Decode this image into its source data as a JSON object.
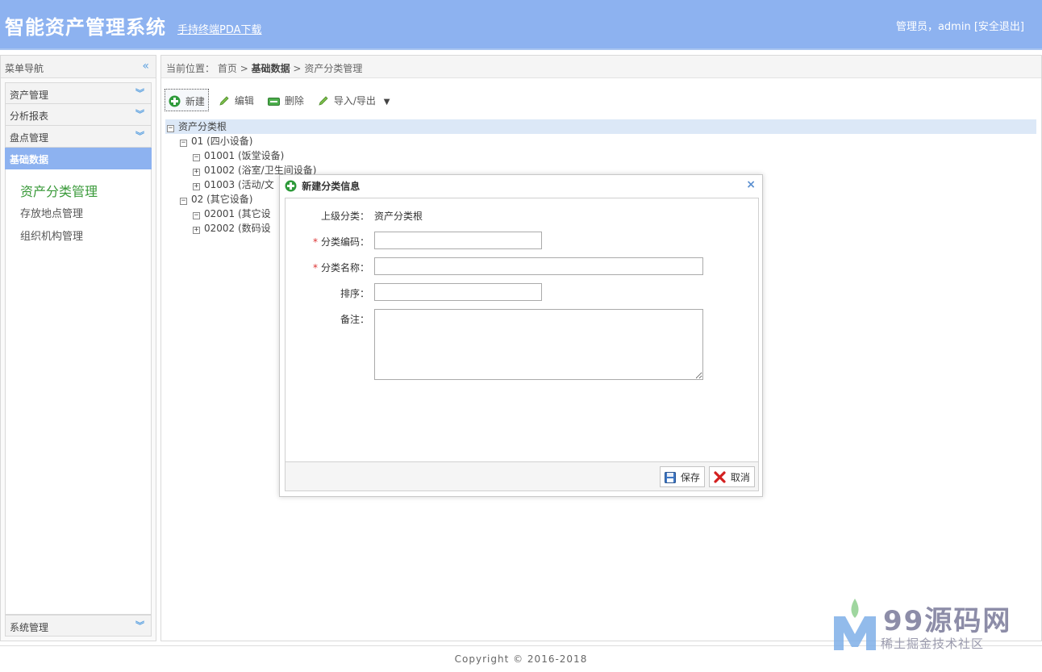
{
  "header": {
    "title": "智能资产管理系统",
    "pda_link": "手持终端PDA下载",
    "user": "管理员，admin",
    "logout": "[安全退出]"
  },
  "sidebar": {
    "title": "菜单导航",
    "collapse_icon": "double-chevron-left-icon",
    "items": [
      {
        "label": "资产管理"
      },
      {
        "label": "分析报表"
      },
      {
        "label": "盘点管理"
      },
      {
        "label": "基础数据",
        "active": true
      }
    ],
    "submenu": [
      {
        "label": "资产分类管理",
        "current": true
      },
      {
        "label": "存放地点管理"
      },
      {
        "label": "组织机构管理"
      }
    ],
    "bottom_item": {
      "label": "系统管理"
    }
  },
  "breadcrumb": {
    "prefix": "当前位置：",
    "home": "首页",
    "sep": ">",
    "section": "基础数据",
    "page": "资产分类管理"
  },
  "toolbar": {
    "new": "新建",
    "edit": "编辑",
    "delete": "删除",
    "import_export": "导入/导出"
  },
  "tree": [
    {
      "label": "资产分类根",
      "toggle": "−",
      "level": 0
    },
    {
      "label": "01 (四小设备)",
      "toggle": "−",
      "level": 1
    },
    {
      "label": "01001 (饭堂设备)",
      "toggle": "−",
      "level": 2
    },
    {
      "label": "01002 (浴室/卫生间设备)",
      "toggle": "+",
      "level": 2
    },
    {
      "label": "01003 (活动/文",
      "toggle": "+",
      "level": 2
    },
    {
      "label": "02 (其它设备)",
      "toggle": "−",
      "level": 1
    },
    {
      "label": "02001 (其它设",
      "toggle": "−",
      "level": 2
    },
    {
      "label": "02002 (数码设",
      "toggle": "+",
      "level": 2
    }
  ],
  "dialog": {
    "title": "新建分类信息",
    "parent_label": "上级分类：",
    "parent_value": "资产分类根",
    "code_label": "分类编码：",
    "name_label": "分类名称：",
    "sort_label": "排序：",
    "remark_label": "备注：",
    "required_mark": "*",
    "code_value": "",
    "name_value": "",
    "sort_value": "",
    "remark_value": "",
    "save": "保存",
    "cancel": "取消"
  },
  "footer": {
    "copyright": "Copyright © 2016-2018"
  },
  "watermark": {
    "brand": "99源码网",
    "subtitle": "稀土掘金技术社区"
  },
  "colors": {
    "header_bg": "#8db2f0",
    "accent": "#5aa0e0",
    "submenu_current": "#3a9a3a",
    "tree_selected": "#dce8f7"
  }
}
